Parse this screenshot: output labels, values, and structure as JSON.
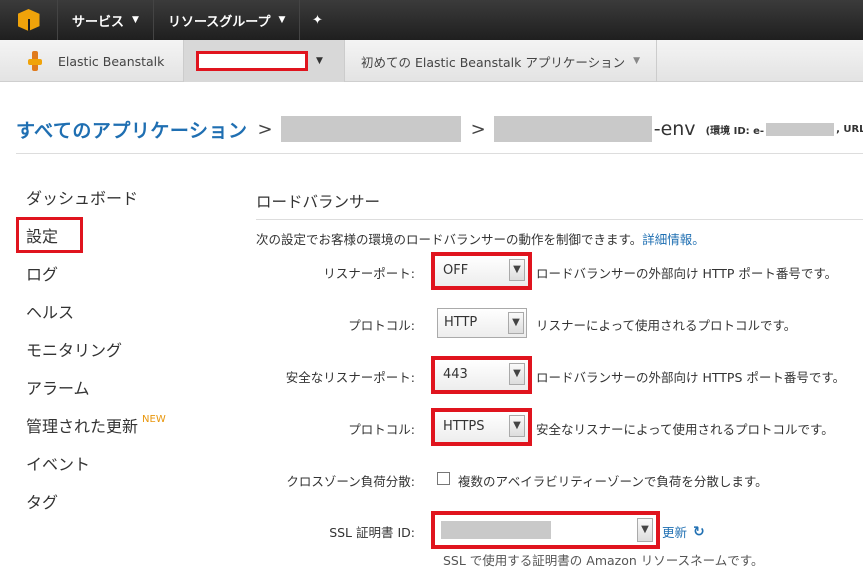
{
  "topbar": {
    "services": "サービス",
    "resource_groups": "リソースグループ",
    "pin_icon": "pin-icon"
  },
  "subbar": {
    "service_name": "Elastic Beanstalk",
    "first_app": "初めての Elastic Beanstalk アプリケーション"
  },
  "breadcrumb": {
    "all_apps": "すべてのアプリケーション",
    "env_suffix": "-env",
    "env_id_label": "(環境 ID: e-",
    "url_label": ", URL: a"
  },
  "nav": {
    "items": [
      {
        "label": "ダッシュボード"
      },
      {
        "label": "設定"
      },
      {
        "label": "ログ"
      },
      {
        "label": "ヘルス"
      },
      {
        "label": "モニタリング"
      },
      {
        "label": "アラーム"
      },
      {
        "label": "管理された更新"
      },
      {
        "label": "イベント"
      },
      {
        "label": "タグ"
      }
    ],
    "new_badge": "NEW"
  },
  "section": {
    "title": "ロードバランサー",
    "description": "次の設定でお客様の環境のロードバランサーの動作を制御できます。",
    "more_info": "詳細情報。"
  },
  "form": {
    "listener_port": {
      "label": "リスナーポート:",
      "value": "OFF",
      "help": "ロードバランサーの外部向け HTTP ポート番号です。"
    },
    "protocol": {
      "label": "プロトコル:",
      "value": "HTTP",
      "help": "リスナーによって使用されるプロトコルです。"
    },
    "secure_listener_port": {
      "label": "安全なリスナーポート:",
      "value": "443",
      "help": "ロードバランサーの外部向け HTTPS ポート番号です。"
    },
    "secure_protocol": {
      "label": "プロトコル:",
      "value": "HTTPS",
      "help": "安全なリスナーによって使用されるプロトコルです。"
    },
    "cross_zone": {
      "label": "クロスゾーン負荷分散:",
      "checkbox_label": "複数のアベイラビリティーゾーンで負荷を分散します。"
    },
    "ssl_cert": {
      "label": "SSL 証明書 ID:",
      "refresh": "更新",
      "help": "SSL で使用する証明書の Amazon リソースネームです。"
    }
  },
  "colors": {
    "accent": "#1f6fb2",
    "highlight": "#e0141e",
    "new_badge": "#e8960c"
  }
}
